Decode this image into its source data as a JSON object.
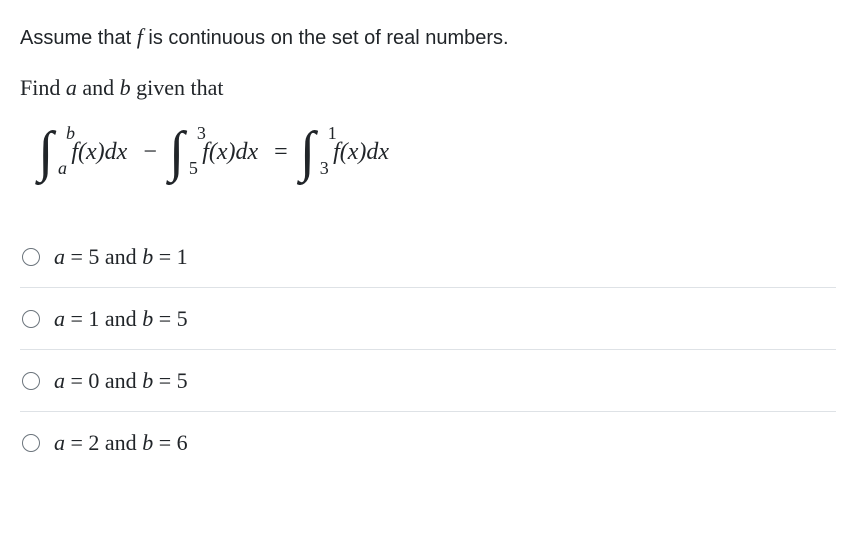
{
  "intro_pre": "Assume that ",
  "intro_f": "f",
  "intro_post": " is continuous on the set of real numbers.",
  "prompt_pre": "Find ",
  "prompt_a": "a",
  "prompt_and": " and ",
  "prompt_b": "b",
  "prompt_post": " given that",
  "eq": {
    "int1": {
      "upper": "b",
      "lower": "a",
      "integrand_f": "f",
      "integrand_rest": "(x)dx"
    },
    "minus": "−",
    "int2": {
      "upper": "3",
      "lower": "5",
      "integrand_f": "f",
      "integrand_rest": "(x)dx"
    },
    "equals": "=",
    "int3": {
      "upper": "1",
      "lower": "3",
      "integrand_f": "f",
      "integrand_rest": "(x)dx"
    }
  },
  "options": [
    {
      "a": "a",
      "eq1": " = 5",
      "and": " and ",
      "b": "b",
      "eq2": " = 1"
    },
    {
      "a": "a",
      "eq1": " = 1",
      "and": " and ",
      "b": "b",
      "eq2": " = 5"
    },
    {
      "a": "a",
      "eq1": " = 0",
      "and": " and ",
      "b": "b",
      "eq2": " = 5"
    },
    {
      "a": "a",
      "eq1": " = 2",
      "and": " and ",
      "b": "b",
      "eq2": " = 6"
    }
  ]
}
